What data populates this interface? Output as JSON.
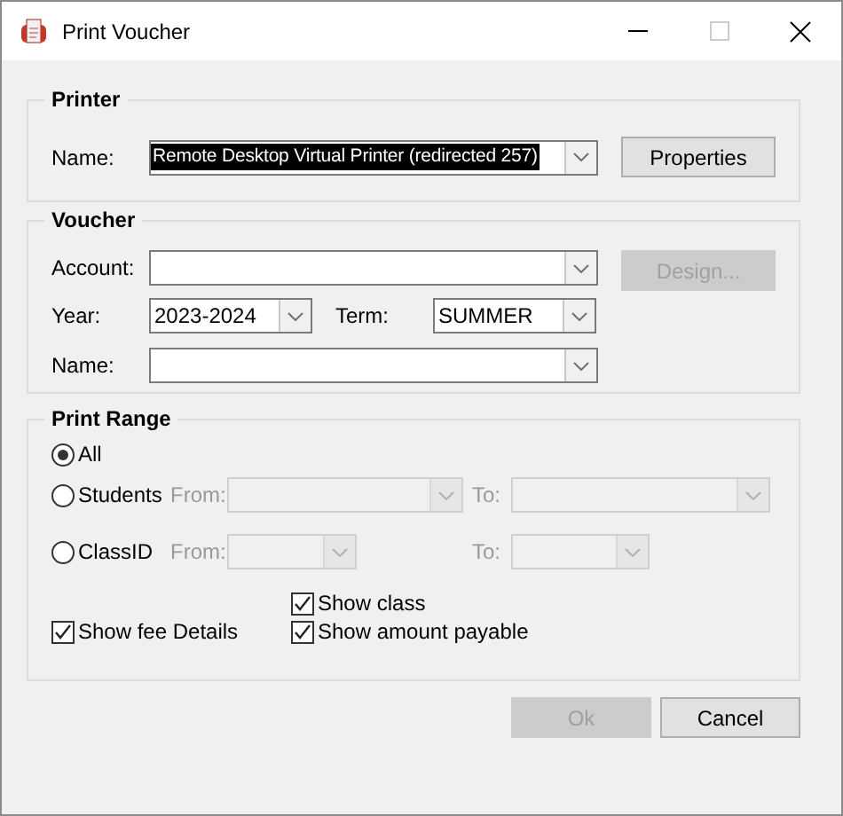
{
  "window": {
    "title": "Print Voucher"
  },
  "printer": {
    "legend": "Printer",
    "name_label": "Name:",
    "name_value": "Remote Desktop Virtual Printer (redirected 257)",
    "name_highlighted": true,
    "properties_button": {
      "label": "Properties",
      "disabled": false
    }
  },
  "voucher": {
    "legend": "Voucher",
    "account_label": "Account:",
    "design_button": {
      "label": "Design...",
      "disabled": true
    },
    "year_label": "Year:",
    "year_value": "2023-2024",
    "term_label": "Term:",
    "term_value": "SUMMER",
    "name_label": "Name:"
  },
  "print_range": {
    "legend": "Print Range",
    "options": [
      {
        "kind": "plain",
        "label": "All",
        "selected": true
      },
      {
        "kind": "range",
        "label": "Students",
        "selected": false,
        "from_label": "From:",
        "to_label": "To:",
        "disabled": true
      },
      {
        "kind": "range",
        "label": "ClassID",
        "selected": false,
        "from_label": "From:",
        "to_label": "To:",
        "disabled": true
      }
    ],
    "checkboxes": [
      {
        "label": "Show class",
        "checked": true
      },
      {
        "label": "Show fee Details",
        "checked": true
      },
      {
        "label": "Show amount payable",
        "checked": true
      }
    ]
  },
  "buttons": [
    {
      "label": "Ok",
      "disabled": true
    },
    {
      "label": "Cancel",
      "disabled": false
    }
  ]
}
